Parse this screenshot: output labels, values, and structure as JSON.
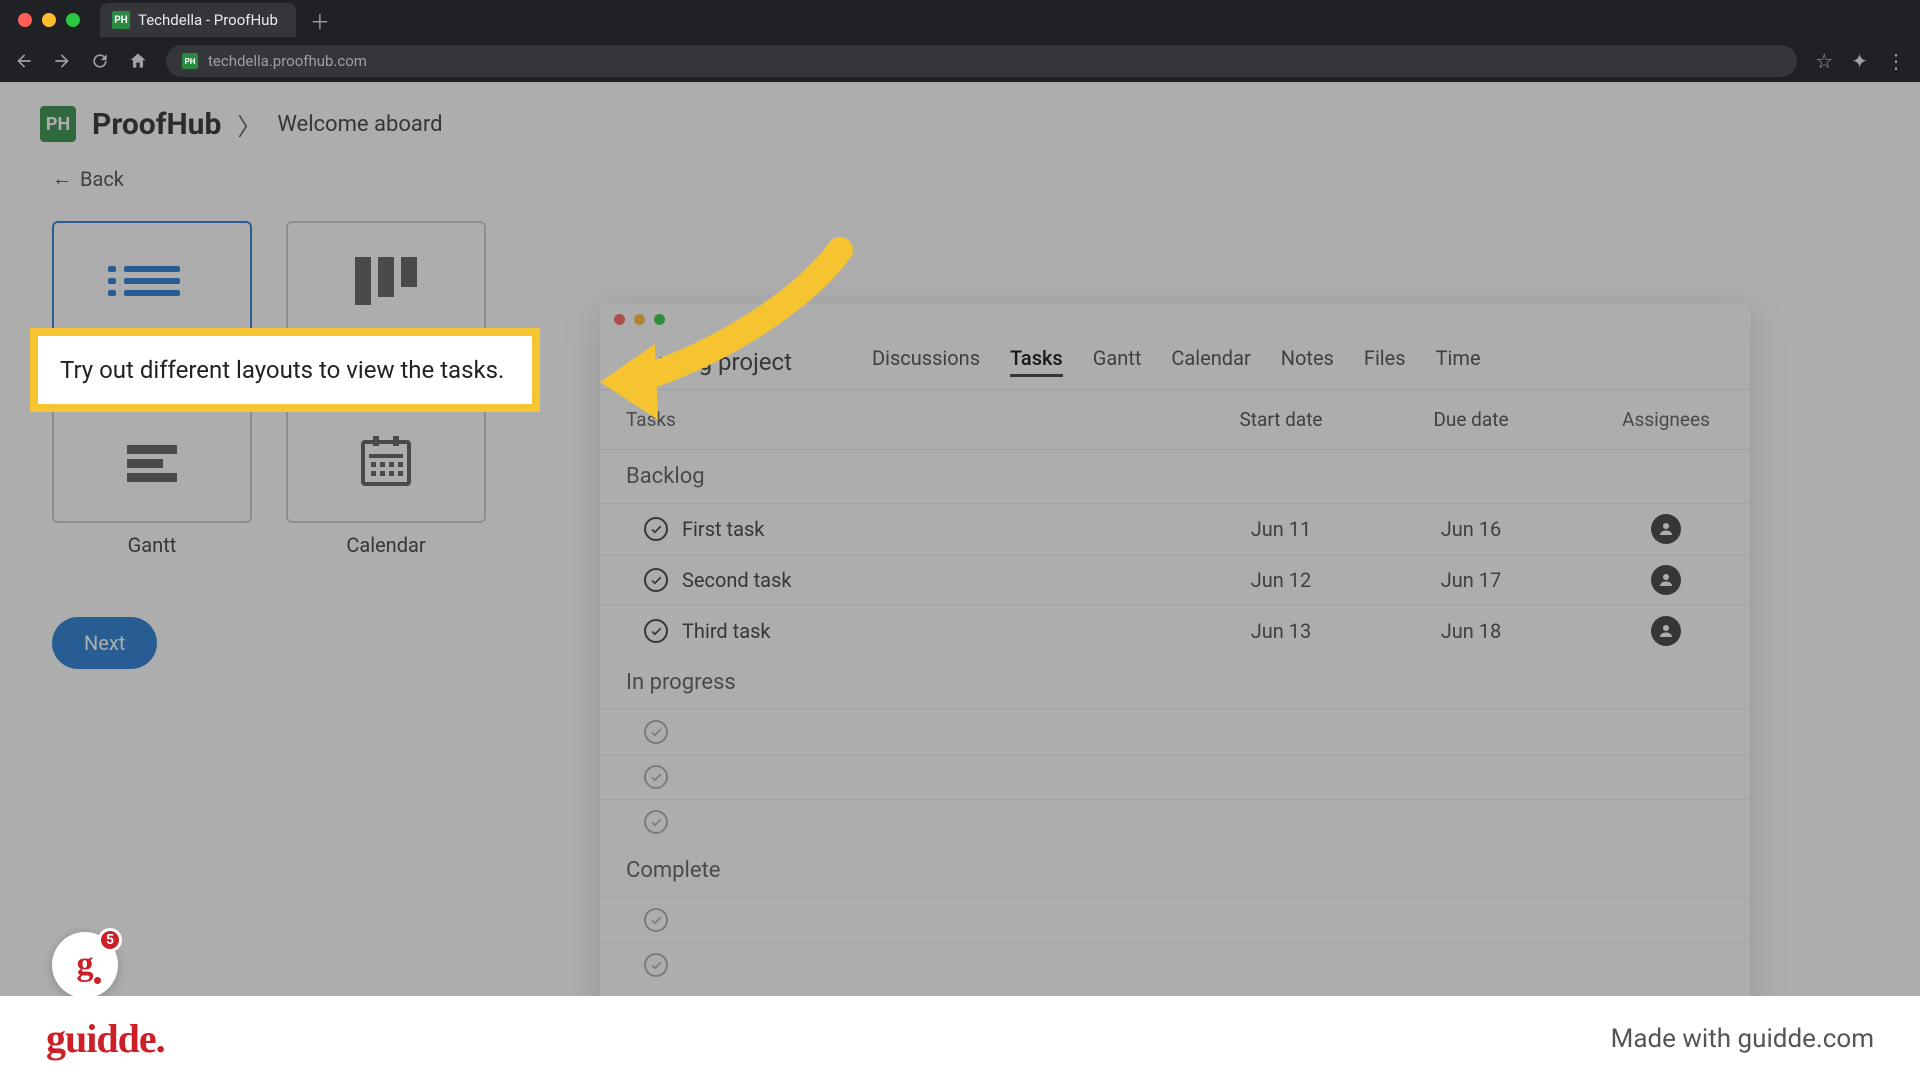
{
  "browser": {
    "tab_title": "Techdella - ProofHub",
    "url": "techdella.proofhub.com"
  },
  "header": {
    "logo_text": "PH",
    "app_name": "ProofHub",
    "breadcrumb": "Welcome aboard"
  },
  "back_label": "Back",
  "callout_text": "Try out different layouts to view the tasks.",
  "layouts": {
    "table": "Table",
    "board": "Board",
    "gantt": "Gantt",
    "calendar": "Calendar"
  },
  "next_button": "Next",
  "guidde_badge_count": "5",
  "preview": {
    "project_name": "...arding project",
    "tabs": [
      "Discussions",
      "Tasks",
      "Gantt",
      "Calendar",
      "Notes",
      "Files",
      "Time"
    ],
    "active_tab": "Tasks",
    "columns": {
      "tasks": "Tasks",
      "start": "Start date",
      "due": "Due date",
      "assignees": "Assignees"
    },
    "sections": {
      "backlog": {
        "title": "Backlog",
        "rows": [
          {
            "name": "First task",
            "start": "Jun 11",
            "due": "Jun 16"
          },
          {
            "name": "Second task",
            "start": "Jun 12",
            "due": "Jun 17"
          },
          {
            "name": "Third task",
            "start": "Jun 13",
            "due": "Jun 18"
          }
        ]
      },
      "in_progress": {
        "title": "In progress"
      },
      "complete": {
        "title": "Complete"
      }
    }
  },
  "footer": {
    "brand": "guidde.",
    "made_with": "Made with guidde.com"
  }
}
